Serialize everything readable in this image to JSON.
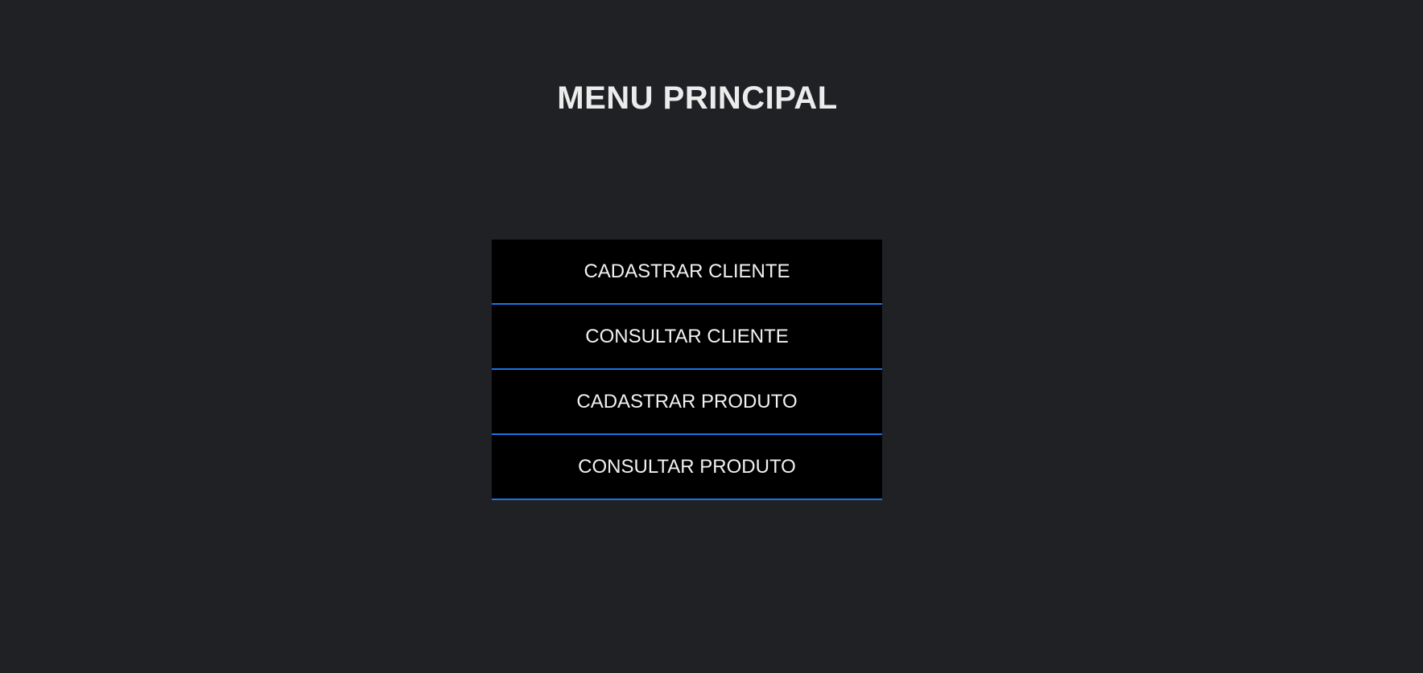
{
  "page": {
    "title": "MENU PRINCIPAL"
  },
  "menu": {
    "items": [
      {
        "label": "CADASTRAR CLIENTE"
      },
      {
        "label": "CONSULTAR CLIENTE"
      },
      {
        "label": "CADASTRAR PRODUTO"
      },
      {
        "label": "CONSULTAR PRODUTO"
      }
    ]
  },
  "colors": {
    "background": "#202125",
    "button_background": "#000000",
    "button_text": "#f2f2f2",
    "divider_accent": "#1a73e8",
    "title_text": "#ececec"
  }
}
